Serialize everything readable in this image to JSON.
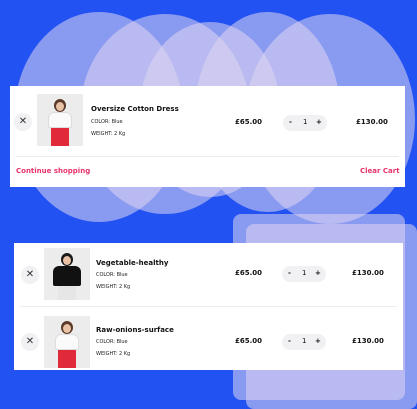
{
  "colors": {
    "background": "#2352f2",
    "accent": "#e8336a"
  },
  "icons": {
    "remove": "close-icon"
  },
  "cart_top": {
    "item": {
      "name": "Oversize Cotton Dress",
      "color_label": "COLOR: Blue",
      "weight_label": "WEIGHT: 2 Kg",
      "price": "£65.00",
      "minus": "-",
      "quantity": "1",
      "plus": "+",
      "total": "£130.00",
      "remove": "✕"
    },
    "continue_label": "Continue shopping",
    "clear_label": "Clear Cart"
  },
  "cart_bottom": {
    "items": [
      {
        "name": "Vegetable-healthy",
        "color_label": "COLOR: Blue",
        "weight_label": "WEIGHT: 2 Kg",
        "price": "£65.00",
        "minus": "-",
        "quantity": "1",
        "plus": "+",
        "total": "£130.00",
        "remove": "✕"
      },
      {
        "name": "Raw-onions-surface",
        "color_label": "COLOR: Blue",
        "weight_label": "WEIGHT: 2 Kg",
        "price": "£65.00",
        "minus": "-",
        "quantity": "1",
        "plus": "+",
        "total": "£130.00",
        "remove": "✕"
      }
    ]
  }
}
